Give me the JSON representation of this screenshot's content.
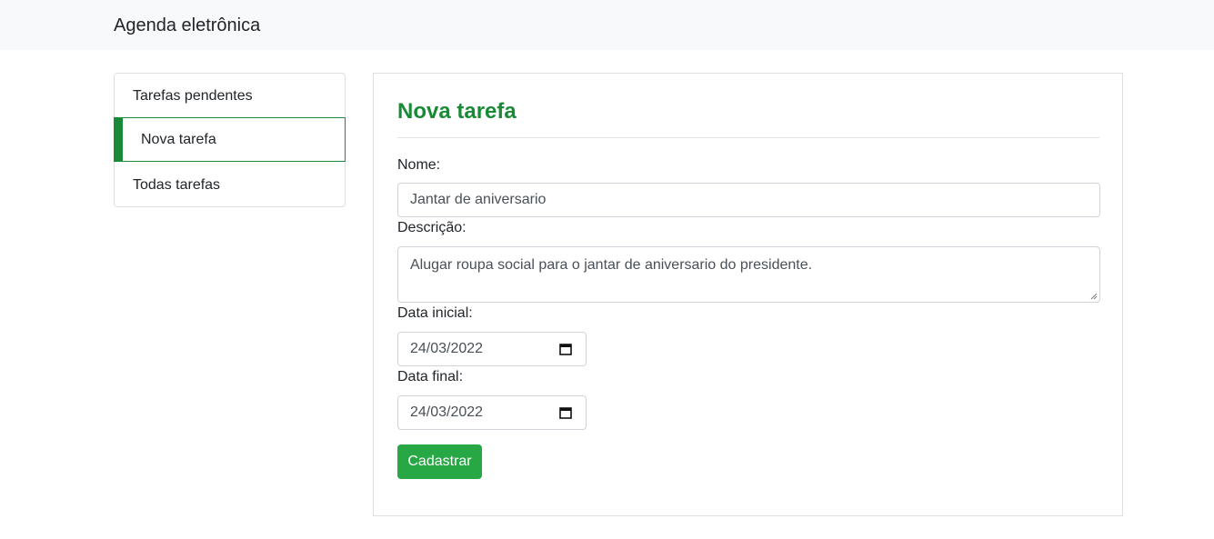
{
  "navbar": {
    "brand": "Agenda eletrônica"
  },
  "sidebar": {
    "items": [
      {
        "label": "Tarefas pendentes",
        "active": false
      },
      {
        "label": "Nova tarefa",
        "active": true
      },
      {
        "label": "Todas tarefas",
        "active": false
      }
    ]
  },
  "form": {
    "title": "Nova tarefa",
    "nome_label": "Nome:",
    "nome_value": "Jantar de aniversario",
    "descricao_label": "Descrição:",
    "descricao_value": "Alugar roupa social para o jantar de aniversario do presidente.",
    "data_inicial_label": "Data inicial:",
    "data_inicial_value": "24/03/2022",
    "data_final_label": "Data final:",
    "data_final_value": "24/03/2022",
    "submit_label": "Cadastrar"
  },
  "colors": {
    "accent": "#198a35",
    "button": "#28a745",
    "navbar_bg": "#f8f9fa"
  },
  "icons": {
    "date_picker": "calendar-icon",
    "resize": "resize-grip-icon"
  }
}
